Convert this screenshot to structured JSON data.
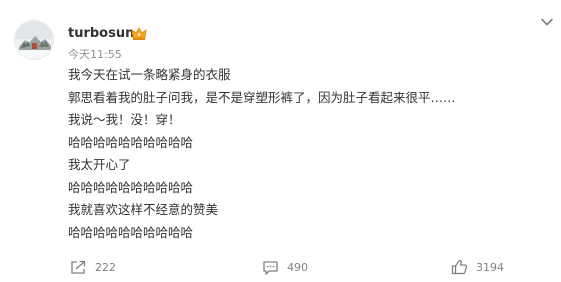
{
  "post": {
    "author": "turbosun",
    "timestamp": "今天11:55",
    "lines": [
      "我今天在试一条略紧身的衣服",
      "郭思看着我的肚子问我，是不是穿塑形裤了，因为肚子看起来很平……",
      "我说～我！没！穿！",
      "哈哈哈哈哈哈哈哈哈哈",
      "我太开心了",
      "哈哈哈哈哈哈哈哈哈哈",
      "我就喜欢这样不经意的赞美",
      "哈哈哈哈哈哈哈哈哈哈"
    ]
  },
  "actions": {
    "repost_count": "222",
    "comment_count": "490",
    "like_count": "3194"
  },
  "icons": {
    "vip": "crown-icon",
    "more": "chevron-down-icon",
    "repost": "share-icon",
    "comment": "comment-icon",
    "like": "thumbs-up-icon"
  },
  "colors": {
    "text": "#333333",
    "muted": "#939393",
    "icon": "#808080",
    "crown": "#f5a623"
  }
}
